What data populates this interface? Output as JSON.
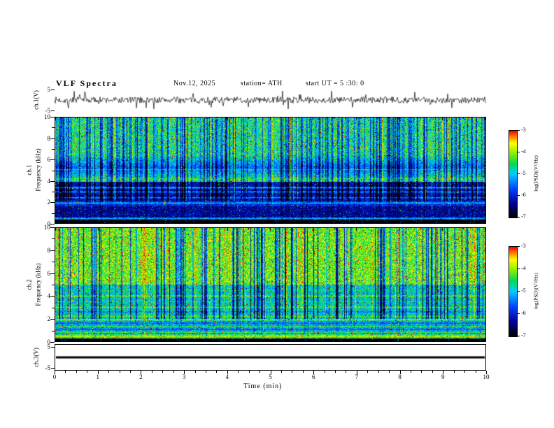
{
  "header": {
    "title": "VLF Spectra",
    "date": "Nov.12, 2025",
    "station": "station= ATH",
    "start_ut": "start UT =  5 :30: 0"
  },
  "x_axis": {
    "label": "Time  (min)",
    "ticks": [
      "0",
      "1",
      "2",
      "3",
      "4",
      "5",
      "6",
      "7",
      "8",
      "9",
      "10"
    ],
    "range": [
      0,
      10
    ]
  },
  "panels": {
    "ch1_wave": {
      "ylabel": "ch.1(V)",
      "ytick_top": "5",
      "ytick_bottom": "-5"
    },
    "ch1_spec": {
      "ylabel_line1": "ch.1",
      "ylabel_line2": "Frequency  (kHz)",
      "yticks": [
        "10",
        "8",
        "6",
        "4",
        "2",
        "0"
      ]
    },
    "ch2_spec": {
      "ylabel_line1": "ch.2",
      "ylabel_line2": "Frequency  (kHz)",
      "yticks": [
        "10",
        "8",
        "6",
        "4",
        "2",
        "0"
      ]
    },
    "ch3_wave": {
      "ylabel": "ch.3(V)",
      "ytick_top": "5",
      "ytick_bottom": "-5"
    }
  },
  "colorbar": {
    "label": "log(PSD)(V²/Hz)",
    "tick_labels": [
      "-3",
      "-4",
      "-5",
      "-6",
      "-7"
    ],
    "range": [
      -7,
      -3
    ],
    "stops": [
      {
        "t": 0.0,
        "color": "#000000"
      },
      {
        "t": 0.16,
        "color": "#000099"
      },
      {
        "t": 0.33,
        "color": "#0044ff"
      },
      {
        "t": 0.5,
        "color": "#00ccff"
      },
      {
        "t": 0.62,
        "color": "#00dd55"
      },
      {
        "t": 0.75,
        "color": "#99ee00"
      },
      {
        "t": 0.86,
        "color": "#ffff00"
      },
      {
        "t": 0.94,
        "color": "#ff7700"
      },
      {
        "t": 1.0,
        "color": "#ff0000"
      }
    ]
  },
  "chart_data": [
    {
      "type": "line",
      "name": "ch.1 waveform",
      "ylabel": "ch.1(V)",
      "xlim": [
        0,
        10
      ],
      "ylim": [
        -5,
        5
      ],
      "baseline": 0,
      "noise_amp": 1.2,
      "spike_prob": 0.05,
      "spike_amp": 3.5,
      "seed": 7,
      "description": "continuous broadband noise trace centred on 0 V with sparse impulsive spikes reaching toward ±5 V"
    },
    {
      "type": "heatmap",
      "name": "ch.1 spectrogram",
      "ylabel": "Frequency (kHz)",
      "xlabel": "Time (min)",
      "xlim": [
        0,
        10
      ],
      "ylim": [
        0,
        10
      ],
      "zlim": [
        -7,
        -3
      ],
      "zlabel": "log(PSD)(V²/Hz)",
      "seed": 13,
      "segments": [
        {
          "f": [
            0,
            0.3
          ],
          "level": -7.0,
          "noise": 0.15,
          "streaks": false
        },
        {
          "f": [
            0.3,
            0.55
          ],
          "level": -5.7,
          "noise": 0.5,
          "streaks": false
        },
        {
          "f": [
            0.55,
            1.6
          ],
          "level": -6.3,
          "noise": 0.45,
          "streaks": false
        },
        {
          "f": [
            1.6,
            2.1
          ],
          "level": -5.9,
          "noise": 0.5,
          "streaks": false
        },
        {
          "f": [
            2.1,
            3.9
          ],
          "level": -6.2,
          "noise": 0.5,
          "streaks": true
        },
        {
          "f": [
            3.9,
            10
          ],
          "level": -4.55,
          "noise": 0.7,
          "streaks": true
        }
      ],
      "bands": [
        {
          "f": 0.45,
          "width": 0.1,
          "level": -5.0
        },
        {
          "f": 1.9,
          "width": 0.12,
          "level": -4.9
        },
        {
          "f": 2.4,
          "width": 0.1,
          "level": -5.1
        },
        {
          "f": 2.95,
          "width": 0.1,
          "level": -5.0
        },
        {
          "f": 3.35,
          "width": 0.12,
          "level": -4.7
        },
        {
          "f": 4.2,
          "width": 0.15,
          "level": -4.3
        },
        {
          "f": 5.3,
          "width": 1.2,
          "level": -5.5
        },
        {
          "f": 5.05,
          "width": 0.1,
          "level": -4.6
        }
      ],
      "streaks": {
        "dark_density": 0.3,
        "dark_depth": 1.8,
        "bright_density": 0.1,
        "bright_boost": 0.9,
        "speckle_bright": 0.025,
        "speckle_dark": 0.03
      }
    },
    {
      "type": "heatmap",
      "name": "ch.2 spectrogram",
      "ylabel": "Frequency (kHz)",
      "xlabel": "Time (min)",
      "xlim": [
        0,
        10
      ],
      "ylim": [
        0,
        10
      ],
      "zlim": [
        -7,
        -3
      ],
      "zlabel": "log(PSD)(V²/Hz)",
      "seed": 29,
      "segments": [
        {
          "f": [
            0,
            0.25
          ],
          "level": -7.0,
          "noise": 0.15,
          "streaks": false
        },
        {
          "f": [
            0.25,
            0.6
          ],
          "level": -4.3,
          "noise": 0.4,
          "streaks": false
        },
        {
          "f": [
            0.6,
            2.0
          ],
          "level": -5.1,
          "noise": 0.6,
          "streaks": false
        },
        {
          "f": [
            2.0,
            5.0
          ],
          "level": -4.9,
          "noise": 0.6,
          "streaks": true
        },
        {
          "f": [
            5.0,
            10
          ],
          "level": -4.15,
          "noise": 0.6,
          "streaks": true
        }
      ],
      "bands": [
        {
          "f": 0.45,
          "width": 0.07,
          "level": -3.5
        },
        {
          "f": 0.8,
          "width": 0.08,
          "level": -4.0
        },
        {
          "f": 1.05,
          "width": 0.07,
          "level": -5.9
        },
        {
          "f": 1.3,
          "width": 0.08,
          "level": -4.1
        },
        {
          "f": 1.6,
          "width": 0.07,
          "level": -5.8
        },
        {
          "f": 1.9,
          "width": 0.1,
          "level": -3.7
        },
        {
          "f": 2.2,
          "width": 0.08,
          "level": -4.2
        },
        {
          "f": 2.6,
          "width": 0.08,
          "level": -5.6
        },
        {
          "f": 3.0,
          "width": 0.1,
          "level": -4.1
        },
        {
          "f": 3.5,
          "width": 0.08,
          "level": -4.5
        },
        {
          "f": 4.0,
          "width": 0.1,
          "level": -4.0
        },
        {
          "f": 4.5,
          "width": 0.08,
          "level": -4.6
        }
      ],
      "streaks": {
        "dark_density": 0.2,
        "dark_depth": 2.4,
        "bright_density": 0.12,
        "bright_boost": 0.8,
        "speckle_bright": 0.04,
        "speckle_dark": 0.02
      }
    },
    {
      "type": "line",
      "name": "ch.3 waveform",
      "ylabel": "ch.3(V)",
      "xlim": [
        0,
        10
      ],
      "ylim": [
        -5,
        5
      ],
      "baseline": 0,
      "noise_amp": 0,
      "spike_prob": 0,
      "spike_amp": 0,
      "seed": 3,
      "description": "flat heavy black line at 0 V across the whole record (no signal on channel 3)"
    }
  ]
}
